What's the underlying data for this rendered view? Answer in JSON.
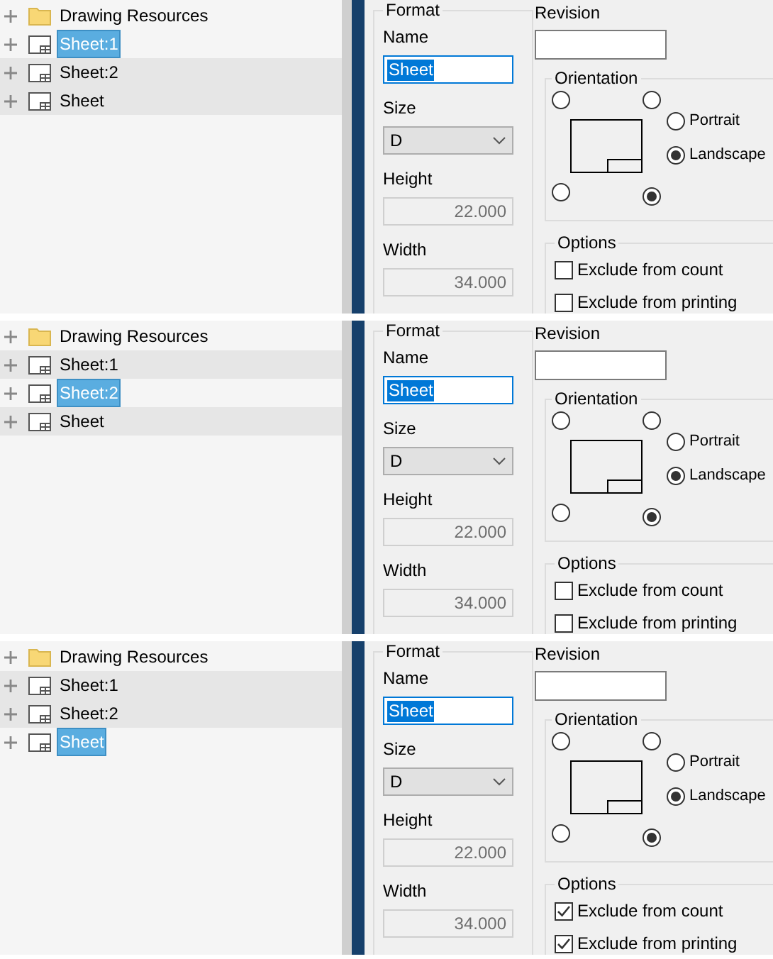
{
  "panels": [
    {
      "tree": [
        {
          "kind": "folder",
          "label": "Drawing Resources",
          "selected": false
        },
        {
          "kind": "sheet",
          "label": "Sheet:1",
          "selected": true
        },
        {
          "kind": "sheet",
          "label": "Sheet:2",
          "selected": false
        },
        {
          "kind": "sheet",
          "label": "Sheet",
          "selected": false
        }
      ],
      "format": {
        "legend": "Format",
        "name_label": "Name",
        "name_value": "Sheet",
        "size_label": "Size",
        "size_value": "D",
        "height_label": "Height",
        "height_value": "22.000",
        "height_disabled": true,
        "width_label": "Width",
        "width_value": "34.000",
        "width_disabled": true
      },
      "revision_label": "Revision",
      "orientation": {
        "legend": "Orientation",
        "corners": [
          {
            "selected": false
          },
          {
            "selected": false
          },
          {
            "selected": false
          },
          {
            "selected": true
          }
        ],
        "choices": [
          {
            "label": "Portrait",
            "selected": false
          },
          {
            "label": "Landscape",
            "selected": true
          }
        ]
      },
      "options": {
        "legend": "Options",
        "items": [
          {
            "label": "Exclude from count",
            "checked": false
          },
          {
            "label": "Exclude from printing",
            "checked": false
          }
        ]
      }
    },
    {
      "tree": [
        {
          "kind": "folder",
          "label": "Drawing Resources",
          "selected": false
        },
        {
          "kind": "sheet",
          "label": "Sheet:1",
          "selected": false
        },
        {
          "kind": "sheet",
          "label": "Sheet:2",
          "selected": true
        },
        {
          "kind": "sheet",
          "label": "Sheet",
          "selected": false
        }
      ],
      "format": {
        "legend": "Format",
        "name_label": "Name",
        "name_value": "Sheet",
        "size_label": "Size",
        "size_value": "D",
        "height_label": "Height",
        "height_value": "22.000",
        "height_disabled": true,
        "width_label": "Width",
        "width_value": "34.000",
        "width_disabled": true
      },
      "revision_label": "Revision",
      "orientation": {
        "legend": "Orientation",
        "corners": [
          {
            "selected": false
          },
          {
            "selected": false
          },
          {
            "selected": false
          },
          {
            "selected": true
          }
        ],
        "choices": [
          {
            "label": "Portrait",
            "selected": false
          },
          {
            "label": "Landscape",
            "selected": true
          }
        ]
      },
      "options": {
        "legend": "Options",
        "items": [
          {
            "label": "Exclude from count",
            "checked": false
          },
          {
            "label": "Exclude from printing",
            "checked": false
          }
        ]
      }
    },
    {
      "tree": [
        {
          "kind": "folder",
          "label": "Drawing Resources",
          "selected": false
        },
        {
          "kind": "sheet",
          "label": "Sheet:1",
          "selected": false
        },
        {
          "kind": "sheet",
          "label": "Sheet:2",
          "selected": false
        },
        {
          "kind": "sheet",
          "label": "Sheet",
          "selected": true
        }
      ],
      "format": {
        "legend": "Format",
        "name_label": "Name",
        "name_value": "Sheet",
        "size_label": "Size",
        "size_value": "D",
        "height_label": "Height",
        "height_value": "22.000",
        "height_disabled": true,
        "width_label": "Width",
        "width_value": "34.000",
        "width_disabled": true
      },
      "revision_label": "Revision",
      "orientation": {
        "legend": "Orientation",
        "corners": [
          {
            "selected": false
          },
          {
            "selected": false
          },
          {
            "selected": false
          },
          {
            "selected": true
          }
        ],
        "choices": [
          {
            "label": "Portrait",
            "selected": false
          },
          {
            "label": "Landscape",
            "selected": true
          }
        ]
      },
      "options": {
        "legend": "Options",
        "items": [
          {
            "label": "Exclude from count",
            "checked": true
          },
          {
            "label": "Exclude from printing",
            "checked": true
          }
        ]
      }
    }
  ]
}
